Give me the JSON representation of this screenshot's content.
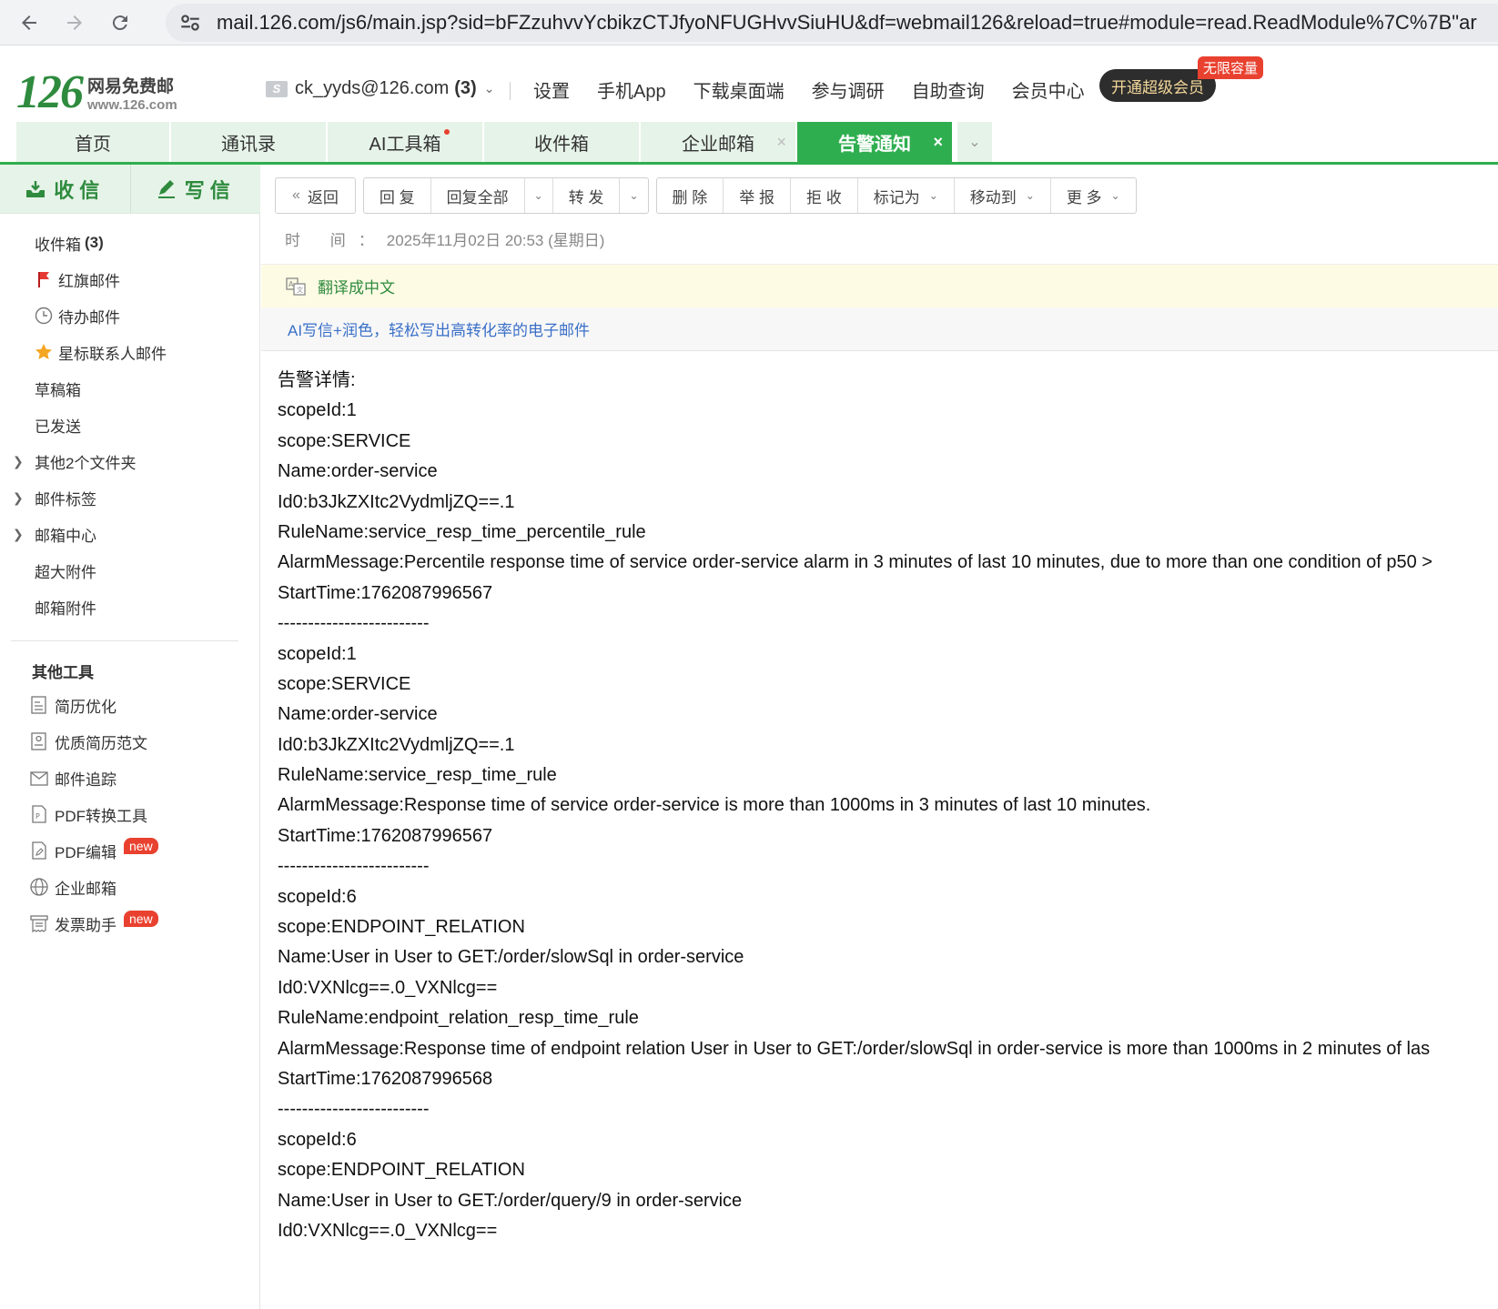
{
  "browser": {
    "url": "mail.126.com/js6/main.jsp?sid=bFZzuhvvYcbikzCTJfyoNFUGHvvSiuHU&df=webmail126&reload=true#module=read.ReadModule%7C%7B\"ar"
  },
  "header": {
    "logo_num": "126",
    "logo_cn": "网易免费邮",
    "logo_url": "www.126.com",
    "account": "ck_yyds@126.com",
    "account_count": "(3)",
    "links": [
      "设置",
      "手机App",
      "下载桌面端",
      "参与调研",
      "自助查询",
      "会员中心"
    ],
    "vip_button": "开通超级会员",
    "vip_tag": "无限容量"
  },
  "tabs": [
    {
      "label": "首页"
    },
    {
      "label": "通讯录"
    },
    {
      "label": "AI工具箱"
    },
    {
      "label": "收件箱"
    },
    {
      "label": "企业邮箱"
    },
    {
      "label": "告警通知"
    }
  ],
  "sidebar": {
    "receive": "收信",
    "compose": "写信",
    "folders": [
      {
        "label": "收件箱",
        "count": "(3)"
      },
      {
        "label": "红旗邮件"
      },
      {
        "label": "待办邮件"
      },
      {
        "label": "星标联系人邮件"
      },
      {
        "label": "草稿箱"
      },
      {
        "label": "已发送"
      },
      {
        "label": "其他2个文件夹"
      },
      {
        "label": "邮件标签"
      },
      {
        "label": "邮箱中心"
      },
      {
        "label": "超大附件"
      },
      {
        "label": "邮箱附件"
      }
    ],
    "tools_title": "其他工具",
    "tools": [
      {
        "label": "简历优化"
      },
      {
        "label": "优质简历范文"
      },
      {
        "label": "邮件追踪"
      },
      {
        "label": "PDF转换工具"
      },
      {
        "label": "PDF编辑",
        "badge": "new"
      },
      {
        "label": "企业邮箱"
      },
      {
        "label": "发票助手",
        "badge": "new"
      }
    ]
  },
  "toolbar": {
    "back": "返回",
    "reply": "回 复",
    "reply_all": "回复全部",
    "forward": "转 发",
    "delete": "删 除",
    "report": "举 报",
    "reject": "拒 收",
    "mark_as": "标记为",
    "move_to": "移动到",
    "more": "更 多"
  },
  "meta": {
    "time_label": "时 间：",
    "time_value": "2025年11月02日 20:53 (星期日)"
  },
  "translate": "翻译成中文",
  "ai_promo": "AI写信+润色，轻松写出高转化率的电子邮件",
  "body_lines": [
    "告警详情:",
    "scopeId:1",
    "scope:SERVICE",
    "Name:order-service",
    "Id0:b3JkZXItc2VydmljZQ==.1",
    "RuleName:service_resp_time_percentile_rule",
    "AlarmMessage:Percentile response time of service order-service alarm in 3 minutes of last 10 minutes, due to more than one condition of p50 >",
    "StartTime:1762087996567",
    "-------------------------",
    "scopeId:1",
    "scope:SERVICE",
    "Name:order-service",
    "Id0:b3JkZXItc2VydmljZQ==.1",
    "RuleName:service_resp_time_rule",
    "AlarmMessage:Response time of service order-service is more than 1000ms in 3 minutes of last 10 minutes.",
    "StartTime:1762087996567",
    "-------------------------",
    "scopeId:6",
    "scope:ENDPOINT_RELATION",
    "Name:User in User to GET:/order/slowSql in order-service",
    "Id0:VXNlcg==.0_VXNlcg==",
    "RuleName:endpoint_relation_resp_time_rule",
    "AlarmMessage:Response time of endpoint relation User in User to GET:/order/slowSql in order-service is more than 1000ms in 2 minutes of las",
    "StartTime:1762087996568",
    "-------------------------",
    "scopeId:6",
    "scope:ENDPOINT_RELATION",
    "Name:User in User to GET:/order/query/9 in order-service",
    "Id0:VXNlcg==.0_VXNlcg=="
  ]
}
